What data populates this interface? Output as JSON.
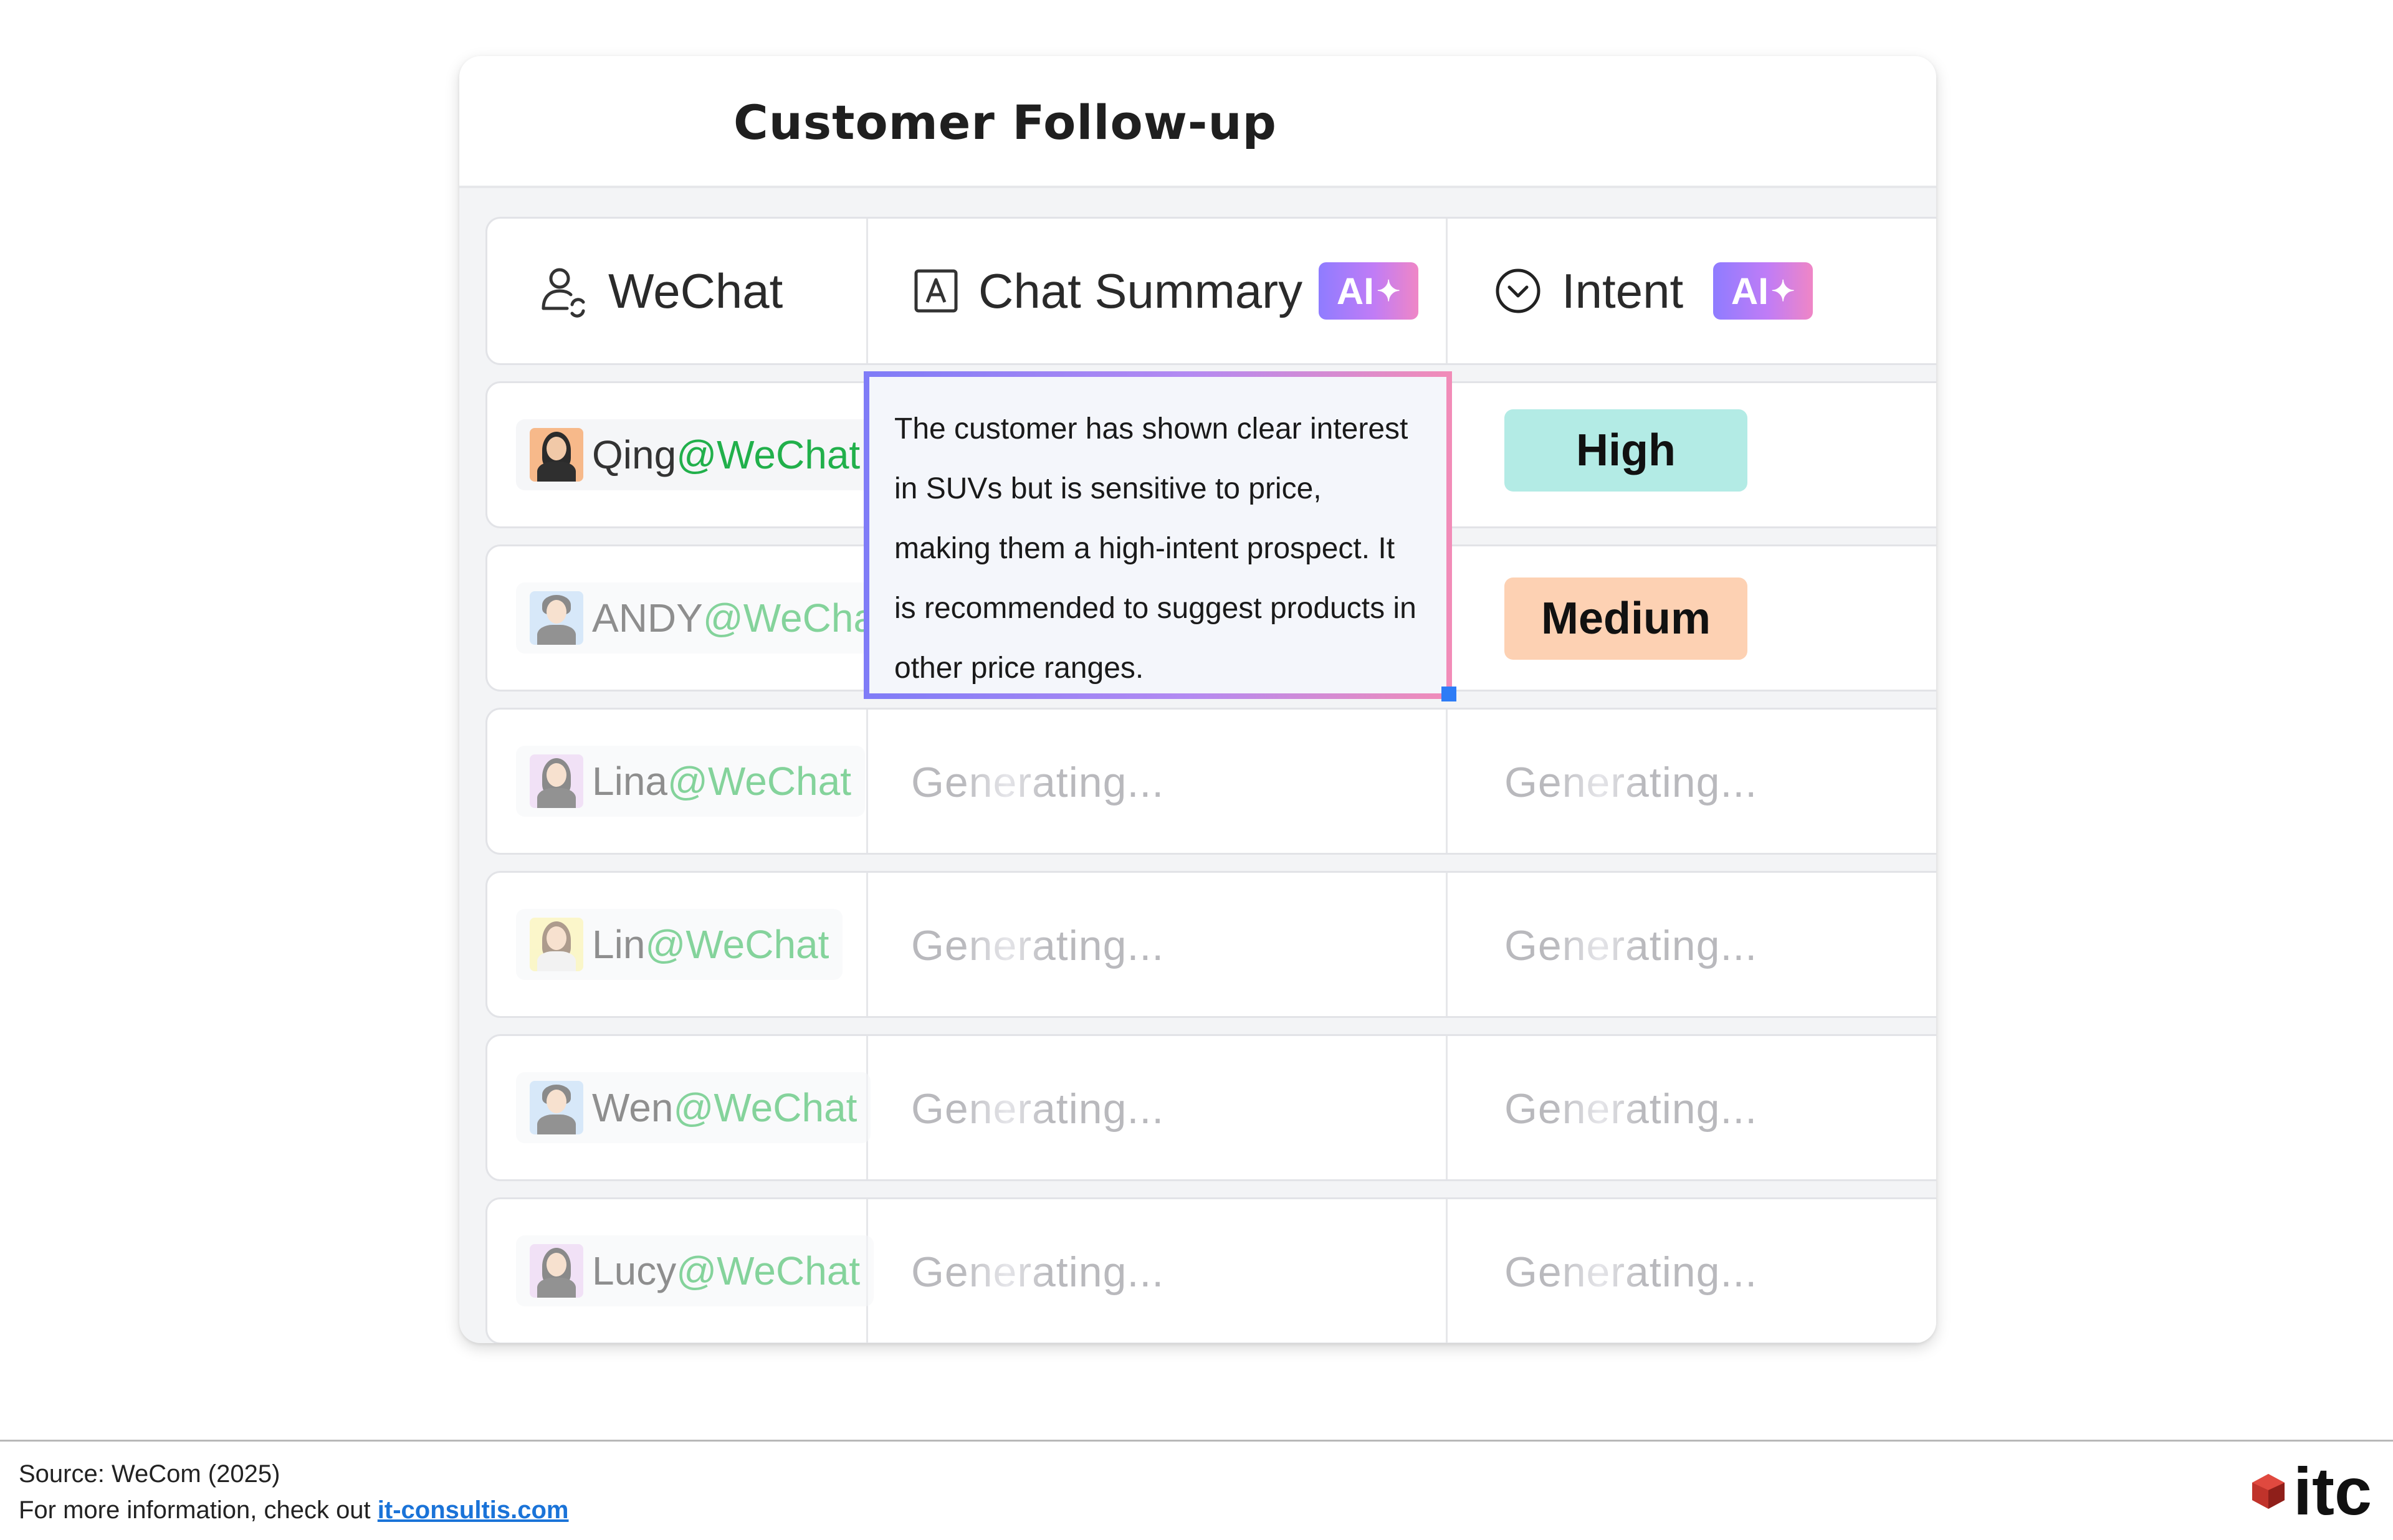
{
  "card": {
    "title": "Customer Follow-up"
  },
  "columns": {
    "wechat": {
      "label": "WeChat",
      "icon": "user-sync-icon"
    },
    "summary": {
      "label": "Chat Summary",
      "icon": "text-box-icon",
      "badge": "AI"
    },
    "intent": {
      "label": "Intent",
      "icon": "chevron-circle-icon",
      "badge": "AI"
    }
  },
  "rows": [
    {
      "name": "Qing",
      "handle": "@WeChat",
      "intent": "High",
      "intent_color": "#b3ebe5"
    },
    {
      "name": "ANDY",
      "handle": "@WeCha",
      "intent": "Medium",
      "intent_color": "#fdd1b3"
    },
    {
      "name": "Lina",
      "handle": "@WeChat",
      "summary": "Generating...",
      "intent": "Generating..."
    },
    {
      "name": "Lin",
      "handle": "@WeChat",
      "summary": "Generating...",
      "intent": "Generating..."
    },
    {
      "name": "Wen",
      "handle": "@WeChat",
      "summary": "Generating...",
      "intent": "Generating..."
    },
    {
      "name": "Lucy",
      "handle": "@WeChat",
      "summary": "Generating...",
      "intent": "Generating..."
    }
  ],
  "popup": {
    "text": "The customer has shown clear interest in SUVs but is sensitive to price, making them a high-intent prospect. It is recommended to suggest products in other price ranges."
  },
  "footer": {
    "source": "Source: WeCom (2025)",
    "more_prefix": "For more information, check out ",
    "more_link": "it-consultis.com",
    "logo_text": "itc"
  },
  "colors": {
    "accent_green": "#21b04b",
    "ai_gradient_start": "#8f7cff",
    "ai_gradient_end": "#ef86c6",
    "link": "#1a73d8",
    "logo_red": "#c0332b"
  }
}
